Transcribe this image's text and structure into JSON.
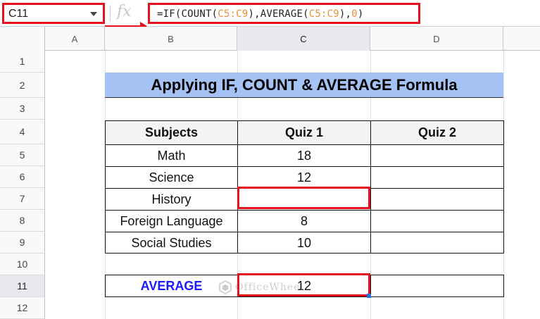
{
  "formula_bar": {
    "name_box": "C11",
    "fx_label": "fx",
    "formula_parts": [
      {
        "text": "=IF(COUNT(",
        "color": "#222222"
      },
      {
        "text": "C5:C9",
        "color": "#e8903a"
      },
      {
        "text": "),AVERAGE(",
        "color": "#222222"
      },
      {
        "text": "C5:C9",
        "color": "#e8903a"
      },
      {
        "text": "),",
        "color": "#222222"
      },
      {
        "text": "0",
        "color": "#e8903a"
      },
      {
        "text": ")",
        "color": "#222222"
      }
    ]
  },
  "columns": [
    "A",
    "B",
    "C",
    "D"
  ],
  "rows": [
    "1",
    "2",
    "3",
    "4",
    "5",
    "6",
    "7",
    "8",
    "9",
    "10",
    "11",
    "12"
  ],
  "sheet": {
    "title": "Applying IF, COUNT & AVERAGE Formula",
    "headers": [
      "Subjects",
      "Quiz 1",
      "Quiz 2"
    ],
    "data": [
      [
        "Math",
        "18",
        ""
      ],
      [
        "Science",
        "12",
        ""
      ],
      [
        "History",
        "",
        ""
      ],
      [
        "Foreign Language",
        "8",
        ""
      ],
      [
        "Social Studies",
        "10",
        ""
      ]
    ],
    "average_label": "AVERAGE",
    "average_value": "12"
  },
  "watermark": "OfficeWheel",
  "colors": {
    "highlight": "#e8101a",
    "title_bg": "#a4c2f4",
    "average_label": "#1a1aff",
    "formula_range": "#e8903a"
  }
}
